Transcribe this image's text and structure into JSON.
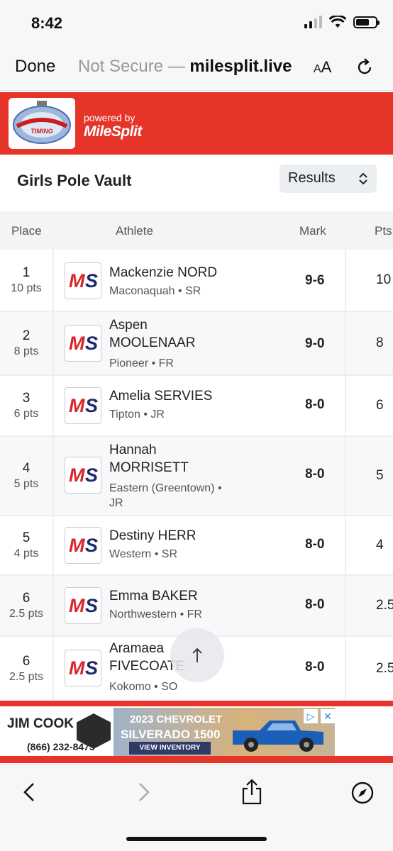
{
  "status_bar": {
    "time": "8:42"
  },
  "browser": {
    "done_label": "Done",
    "security": "Not Secure —",
    "host": "milesplit.live",
    "text_size_label": "A",
    "text_size_big": "A"
  },
  "brand": {
    "partner_logo_text": "ABOVE AND BEYOND TIMING",
    "powered_by": "powered by",
    "milesplit": "MileSplit"
  },
  "event": {
    "title": "Girls Pole Vault",
    "view_select": "Results"
  },
  "table": {
    "headers": {
      "place": "Place",
      "athlete": "Athlete",
      "mark": "Mark",
      "pts": "Pts"
    },
    "logo_text": "MS",
    "rows": [
      {
        "place": "1",
        "pts_label": "10 pts",
        "name": "Mackenzie NORD",
        "team": "Maconaquah • SR",
        "mark": "9-6",
        "pts": "10"
      },
      {
        "place": "2",
        "pts_label": "8 pts",
        "name": "Aspen MOOLENAAR",
        "team": "Pioneer • FR",
        "mark": "9-0",
        "pts": "8"
      },
      {
        "place": "3",
        "pts_label": "6 pts",
        "name": "Amelia SERVIES",
        "team": "Tipton • JR",
        "mark": "8-0",
        "pts": "6"
      },
      {
        "place": "4",
        "pts_label": "5 pts",
        "name": "Hannah MORRISETT",
        "team": "Eastern (Greentown) • JR",
        "mark": "8-0",
        "pts": "5"
      },
      {
        "place": "5",
        "pts_label": "4 pts",
        "name": "Destiny HERR",
        "team": "Western • SR",
        "mark": "8-0",
        "pts": "4"
      },
      {
        "place": "6",
        "pts_label": "2.5 pts",
        "name": "Emma BAKER",
        "team": "Northwestern • FR",
        "mark": "8-0",
        "pts": "2.5"
      },
      {
        "place": "6",
        "pts_label": "2.5 pts",
        "name": "Aramaea FIVECOATE",
        "team": "Kokomo • SO",
        "mark": "8-0",
        "pts": "2.5"
      }
    ]
  },
  "ad": {
    "dealer": "JIM COOK",
    "phone": "(866) 232-8475",
    "line1": "2023 CHEVROLET",
    "line2": "SILVERADO 1500",
    "cta": "VIEW INVENTORY"
  },
  "icons": {
    "reload": "reload-icon",
    "back": "back-chevron-icon",
    "forward": "forward-chevron-icon",
    "share": "share-icon",
    "compass": "compass-icon",
    "scroll_top": "arrow-up-icon"
  },
  "colors": {
    "brand_red": "#e63528",
    "logo_navy": "#1d2a6b",
    "logo_red": "#d9262c"
  }
}
